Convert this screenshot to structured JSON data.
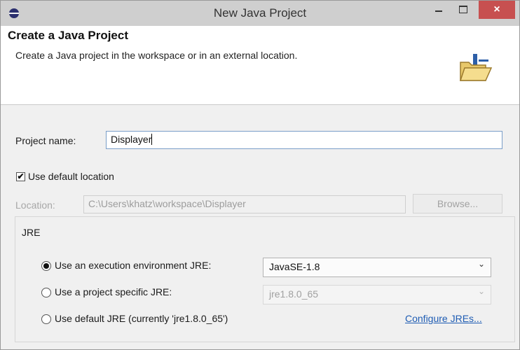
{
  "window": {
    "title": "New Java Project",
    "close_glyph": "×"
  },
  "header": {
    "title": "Create a Java Project",
    "description": "Create a Java project in the workspace or in an external location."
  },
  "project": {
    "name_label": "Project name:",
    "name_value": "Displayer",
    "use_default_location_label": "Use default location",
    "use_default_location_checked": true,
    "check_glyph": "✔",
    "location_label": "Location:",
    "location_value": "C:\\Users\\khatz\\workspace\\Displayer",
    "browse_label": "Browse..."
  },
  "jre": {
    "group_label": "JRE",
    "options": [
      {
        "label": "Use an execution environment JRE:",
        "selected": true,
        "select_value": "JavaSE-1.8"
      },
      {
        "label": "Use a project specific JRE:",
        "selected": false,
        "select_value": "jre1.8.0_65"
      },
      {
        "label": "Use default JRE (currently 'jre1.8.0_65')",
        "selected": false
      }
    ],
    "configure_link": "Configure JREs...",
    "chevron_glyph": "⌄"
  },
  "colors": {
    "accent_link": "#1e5cb3",
    "close_button": "#c75050",
    "input_border": "#7a9ec8"
  },
  "icons": [
    "eclipse-app-icon",
    "minimize-icon",
    "maximize-icon",
    "close-icon",
    "folder-wizard-icon",
    "checkbox-checked-icon",
    "radio-icon",
    "chevron-down-icon"
  ]
}
